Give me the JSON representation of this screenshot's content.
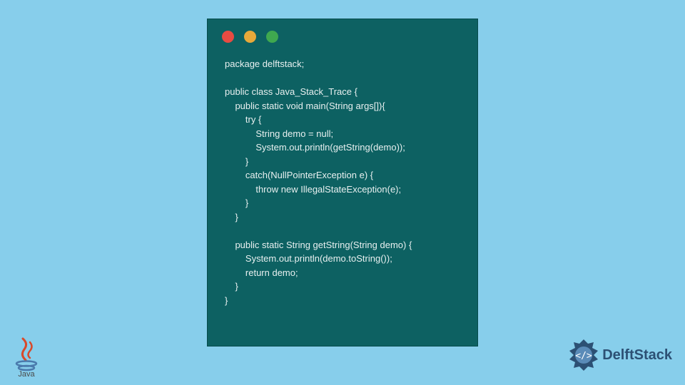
{
  "code": {
    "line1": "package delftstack;",
    "line2": "",
    "line3": "public class Java_Stack_Trace {",
    "line4": "    public static void main(String args[]){",
    "line5": "        try {",
    "line6": "            String demo = null;",
    "line7": "            System.out.println(getString(demo));",
    "line8": "        }",
    "line9": "        catch(NullPointerException e) {",
    "line10": "            throw new IllegalStateException(e);",
    "line11": "        }",
    "line12": "    }",
    "line13": "",
    "line14": "    public static String getString(String demo) {",
    "line15": "        System.out.println(demo.toString());",
    "line16": "        return demo;",
    "line17": "    }",
    "line18": "}"
  },
  "branding": {
    "java_label": "Java",
    "delft_label": "DelftStack"
  }
}
